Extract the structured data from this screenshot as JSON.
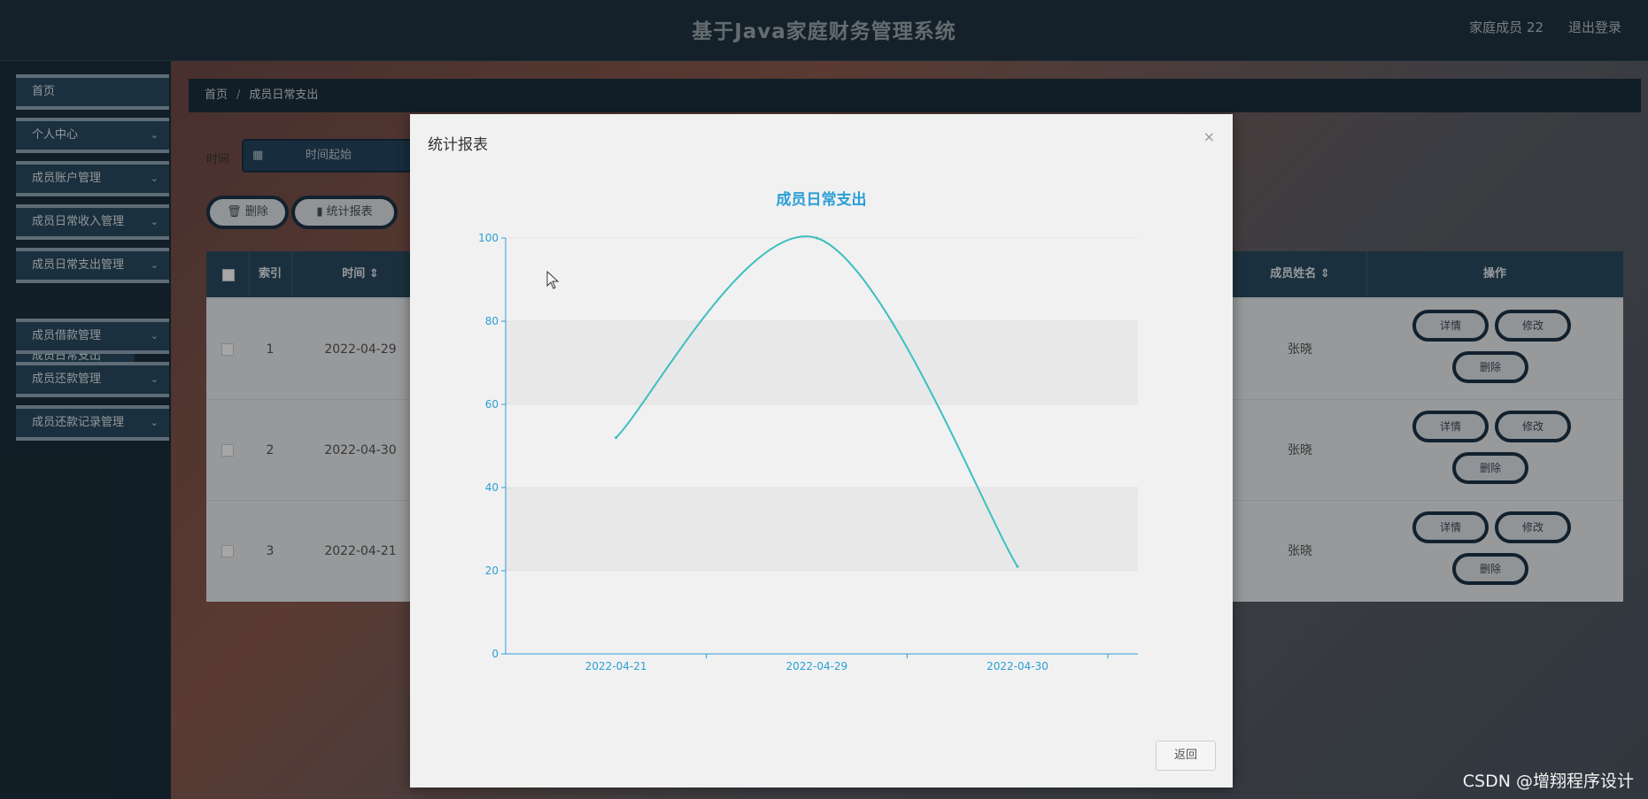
{
  "header": {
    "title": "基于Java家庭财务管理系统",
    "user": "家庭成员 22",
    "logout": "退出登录"
  },
  "sidebar": {
    "items": [
      {
        "label": "首页",
        "expandable": false
      },
      {
        "label": "个人中心",
        "expandable": true
      },
      {
        "label": "成员账户管理",
        "expandable": true
      },
      {
        "label": "成员日常收入管理",
        "expandable": true
      },
      {
        "label": "成员日常支出管理",
        "expandable": true
      },
      {
        "label": "成员借款管理",
        "expandable": true
      },
      {
        "label": "成员还款管理",
        "expandable": true
      },
      {
        "label": "成员还款记录管理",
        "expandable": true
      }
    ],
    "sub_item": "成员日常支出"
  },
  "breadcrumb": {
    "home": "首页",
    "sep": "/",
    "current": "成员日常支出"
  },
  "search": {
    "label": "时间",
    "start_placeholder": "时间起始"
  },
  "toolbar": {
    "delete": "删除",
    "report": "统计报表"
  },
  "table": {
    "headers": {
      "index": "索引",
      "time": "时间",
      "member_name": "成员姓名",
      "actions": "操作"
    },
    "rows": [
      {
        "index": "1",
        "time": "2022-04-29",
        "name": "张晓"
      },
      {
        "index": "2",
        "time": "2022-04-30",
        "name": "张晓"
      },
      {
        "index": "3",
        "time": "2022-04-21",
        "name": "张晓"
      }
    ],
    "row_actions": {
      "detail": "详情",
      "edit": "修改",
      "delete": "删除"
    }
  },
  "modal": {
    "title": "统计报表",
    "close": "×",
    "return": "返回"
  },
  "chart_data": {
    "type": "line",
    "title": "成员日常支出",
    "x": [
      "2022-04-21",
      "2022-04-29",
      "2022-04-30"
    ],
    "values": [
      52,
      100,
      21
    ],
    "ylim": [
      0,
      100
    ],
    "yticks": [
      0,
      20,
      40,
      60,
      80,
      100
    ],
    "smooth": true,
    "color": "#3dbfbf",
    "axis_color": "#2a9fd6"
  },
  "watermark": "CSDN @增翔程序设计",
  "colors": {
    "header_bg": "#1f3341",
    "nav_bg": "#2a4a60",
    "accent": "#2a9fd6"
  }
}
